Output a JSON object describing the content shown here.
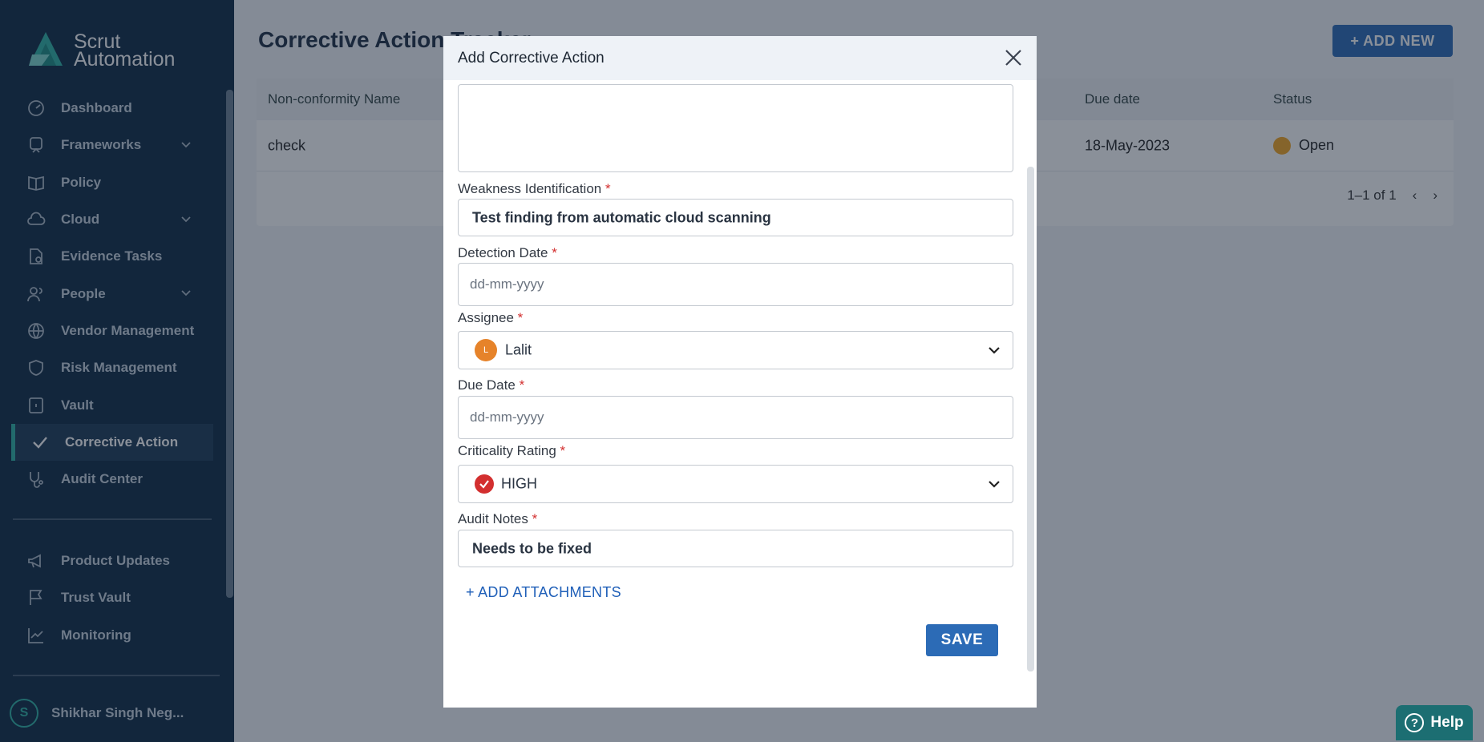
{
  "brand": {
    "name_line1": "Scrut",
    "name_line2": "Automation"
  },
  "sidebar": {
    "items": [
      {
        "label": "Dashboard",
        "icon": "dashboard-icon"
      },
      {
        "label": "Frameworks",
        "icon": "frameworks-icon",
        "expandable": true
      },
      {
        "label": "Policy",
        "icon": "policy-icon"
      },
      {
        "label": "Cloud",
        "icon": "cloud-icon",
        "expandable": true
      },
      {
        "label": "Evidence Tasks",
        "icon": "evidence-icon"
      },
      {
        "label": "People",
        "icon": "people-icon",
        "expandable": true
      },
      {
        "label": "Vendor Management",
        "icon": "vendor-icon"
      },
      {
        "label": "Risk Management",
        "icon": "shield-icon"
      },
      {
        "label": "Vault",
        "icon": "vault-icon"
      },
      {
        "label": "Corrective Action",
        "icon": "check-icon",
        "active": true
      },
      {
        "label": "Audit Center",
        "icon": "audit-icon"
      }
    ],
    "secondary": [
      {
        "label": "Product Updates",
        "icon": "megaphone-icon"
      },
      {
        "label": "Trust Vault",
        "icon": "flag-icon"
      },
      {
        "label": "Monitoring",
        "icon": "monitoring-icon"
      }
    ],
    "user": {
      "initial": "S",
      "name": "Shikhar Singh Neg..."
    }
  },
  "page": {
    "title": "Corrective Action Tracker",
    "add_new_label": "+ ADD NEW",
    "table": {
      "headers": {
        "name": "Non-conformity Name",
        "due": "Due date",
        "status": "Status"
      },
      "rows": [
        {
          "name": "check",
          "due": "18-May-2023",
          "status": "Open"
        }
      ],
      "pagination": "1–1 of 1"
    }
  },
  "modal": {
    "title": "Add Corrective Action",
    "fields": {
      "weakness": {
        "label": "Weakness Identification",
        "value": "Test finding from automatic cloud scanning"
      },
      "detection_date": {
        "label": "Detection Date",
        "placeholder": "dd-mm-yyyy"
      },
      "assignee": {
        "label": "Assignee",
        "value": "Lalit",
        "initial": "L"
      },
      "due_date": {
        "label": "Due Date",
        "placeholder": "dd-mm-yyyy"
      },
      "criticality": {
        "label": "Criticality Rating",
        "value": "HIGH"
      },
      "audit_notes": {
        "label": "Audit Notes",
        "value": "Needs to be fixed"
      }
    },
    "required_mark": "*",
    "add_attachments_label": "+ ADD ATTACHMENTS",
    "save_label": "SAVE"
  },
  "help": {
    "label": "Help"
  },
  "colors": {
    "sidebar_bg": "#0f2a44",
    "accent": "#2fb3a4",
    "primary": "#2c6bb6",
    "required": "#d32f2f",
    "assignee_avatar": "#e6832a"
  }
}
